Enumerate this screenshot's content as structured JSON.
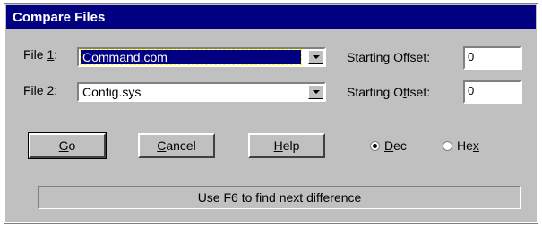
{
  "window": {
    "title": "Compare Files"
  },
  "file1": {
    "label_prefix": "File ",
    "label_hotkey": "1",
    "label_suffix": ":",
    "value": "Command.com"
  },
  "file2": {
    "label_prefix": "File ",
    "label_hotkey": "2",
    "label_suffix": ":",
    "value": "Config.sys"
  },
  "offset1": {
    "label_prefix": "Starting ",
    "label_hotkey": "O",
    "label_suffix": "ffset:",
    "value": "0"
  },
  "offset2": {
    "label_prefix": "Starting O",
    "label_hotkey": "f",
    "label_suffix": "fset:",
    "value": "0"
  },
  "buttons": {
    "go": {
      "hotkey": "G",
      "rest": "o"
    },
    "cancel": {
      "hotkey": "C",
      "rest": "ancel"
    },
    "help": {
      "hotkey": "H",
      "rest": "elp"
    }
  },
  "radix": {
    "dec": {
      "hotkey": "D",
      "rest": "ec",
      "selected": true
    },
    "hex": {
      "prefix": "He",
      "hotkey": "x",
      "selected": false
    }
  },
  "status": {
    "text": "Use F6 to find next difference"
  },
  "colors": {
    "titlebar": "#000080",
    "face": "#c0c0c0",
    "selection": "#000080"
  }
}
